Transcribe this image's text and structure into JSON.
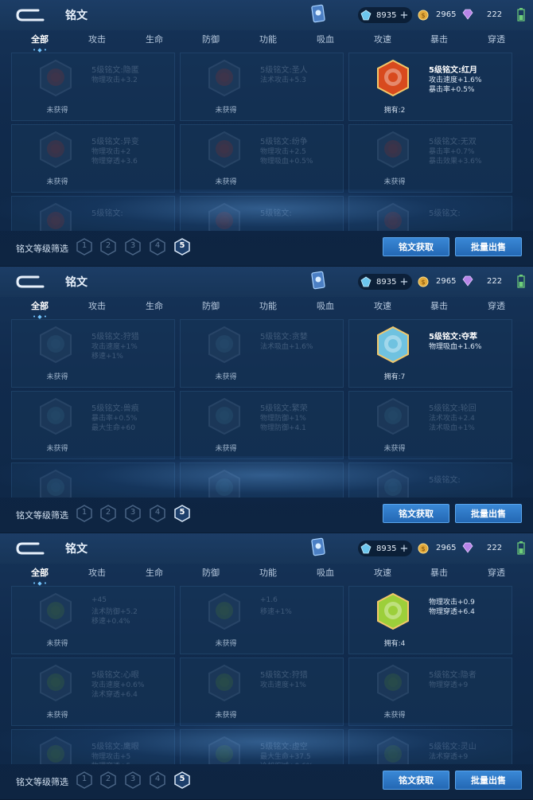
{
  "header": {
    "title": "铭文",
    "gems": "8935",
    "gold": "2965",
    "crystals": "222"
  },
  "tabs": [
    "全部",
    "攻击",
    "生命",
    "防御",
    "功能",
    "吸血",
    "攻速",
    "暴击",
    "穿透"
  ],
  "tab_marker": "• ◆ •",
  "footer": {
    "filter_label": "铭文等级筛选",
    "levels": [
      "1",
      "2",
      "3",
      "4",
      "5"
    ],
    "obtain_button": "铭文获取",
    "sell_button": "批量出售"
  },
  "colors": {
    "accent": "#74c6ff",
    "button": "#2f7ac8",
    "background": "#112b4d"
  },
  "panels": [
    {
      "rows": [
        [
          {
            "name": "5级铭文:隐匿",
            "attrs": [
              "物理攻击+3.2"
            ],
            "status": "未获得",
            "owned": false,
            "color": "#8a3b3b"
          },
          {
            "name": "5级铭文:圣人",
            "attrs": [
              "法术攻击+5.3"
            ],
            "status": "未获得",
            "owned": false,
            "color": "#8a3b3b"
          },
          {
            "name": "5级铭文:红月",
            "attrs": [
              "攻击速度+1.6%",
              "暴击率+0.5%"
            ],
            "status": "拥有:2",
            "owned": true,
            "color": "#d84a1e"
          }
        ],
        [
          {
            "name": "5级铭文:异变",
            "attrs": [
              "物理攻击+2",
              "物理穿透+3.6"
            ],
            "status": "未获得",
            "owned": false,
            "color": "#8a3b3b"
          },
          {
            "name": "5级铭文:纷争",
            "attrs": [
              "物理攻击+2.5",
              "物理吸血+0.5%"
            ],
            "status": "未获得",
            "owned": false,
            "color": "#8a3b3b"
          },
          {
            "name": "5级铭文:无双",
            "attrs": [
              "暴击率+0.7%",
              "暴击效果+3.6%"
            ],
            "status": "未获得",
            "owned": false,
            "color": "#8a3b3b"
          }
        ],
        [
          {
            "name": "5级铭文:",
            "attrs": [],
            "status": "",
            "owned": false,
            "color": "#8a3b3b"
          },
          {
            "name": "5级铭文:",
            "attrs": [],
            "status": "",
            "owned": false,
            "color": "#8a3b3b"
          },
          {
            "name": "5级铭文:",
            "attrs": [],
            "status": "",
            "owned": false,
            "color": "#8a3b3b"
          }
        ]
      ]
    },
    {
      "rows": [
        [
          {
            "name": "5级铭文:狩猎",
            "attrs": [
              "攻击速度+1%",
              "移速+1%"
            ],
            "status": "未获得",
            "owned": false,
            "color": "#3f6f8f"
          },
          {
            "name": "5级铭文:贪婪",
            "attrs": [
              "法术吸血+1.6%"
            ],
            "status": "未获得",
            "owned": false,
            "color": "#3f6f8f"
          },
          {
            "name": "5级铭文:夺萃",
            "attrs": [
              "物理吸血+1.6%"
            ],
            "status": "拥有:7",
            "owned": true,
            "color": "#6fc2e0"
          }
        ],
        [
          {
            "name": "5级铭文:兽痕",
            "attrs": [
              "暴击率+0.5%",
              "最大生命+60"
            ],
            "status": "未获得",
            "owned": false,
            "color": "#3f6f8f"
          },
          {
            "name": "5级铭文:繁荣",
            "attrs": [
              "物理防御+1%",
              "物理防御+4.1"
            ],
            "status": "未获得",
            "owned": false,
            "color": "#3f6f8f"
          },
          {
            "name": "5级铭文:轮回",
            "attrs": [
              "法术攻击+2.4",
              "法术吸血+1%"
            ],
            "status": "未获得",
            "owned": false,
            "color": "#3f6f8f"
          }
        ],
        [
          {
            "name": "",
            "attrs": [],
            "status": "",
            "owned": false,
            "color": "#3f6f8f"
          },
          {
            "name": "",
            "attrs": [],
            "status": "",
            "owned": false,
            "color": "#3f6f8f"
          },
          {
            "name": "5级铭文:",
            "attrs": [],
            "status": "",
            "owned": false,
            "color": "#3f6f8f"
          }
        ]
      ]
    },
    {
      "rows": [
        [
          {
            "name": "",
            "attrs": [
              "+45",
              "法术防御+5.2",
              "移速+0.4%"
            ],
            "status": "未获得",
            "owned": false,
            "color": "#4d7a3e"
          },
          {
            "name": "",
            "attrs": [
              "+1.6",
              "移速+1%"
            ],
            "status": "未获得",
            "owned": false,
            "color": "#4d7a3e"
          },
          {
            "name": "",
            "attrs": [
              "物理攻击+0.9",
              "物理穿透+6.4"
            ],
            "status": "拥有:4",
            "owned": true,
            "color": "#9ccf3a"
          }
        ],
        [
          {
            "name": "5级铭文:心眼",
            "attrs": [
              "攻击速度+0.6%",
              "法术穿透+6.4"
            ],
            "status": "未获得",
            "owned": false,
            "color": "#4d7a3e"
          },
          {
            "name": "5级铭文:狩猎",
            "attrs": [
              "攻击速度+1%"
            ],
            "status": "未获得",
            "owned": false,
            "color": "#4d7a3e"
          },
          {
            "name": "5级铭文:隐者",
            "attrs": [
              "物理穿透+9"
            ],
            "status": "未获得",
            "owned": false,
            "color": "#4d7a3e"
          }
        ],
        [
          {
            "name": "5级铭文:鹰眼",
            "attrs": [
              "物理攻击+5",
              "物理穿透+5"
            ],
            "status": "",
            "owned": false,
            "color": "#4d7a3e"
          },
          {
            "name": "5级铭文:虚空",
            "attrs": [
              "最大生命+37.5",
              "冷却缩减+0.6%"
            ],
            "status": "",
            "owned": false,
            "color": "#4d7a3e"
          },
          {
            "name": "5级铭文:灵山",
            "attrs": [
              "法术穿透+9"
            ],
            "status": "",
            "owned": false,
            "color": "#4d7a3e"
          }
        ]
      ]
    }
  ]
}
